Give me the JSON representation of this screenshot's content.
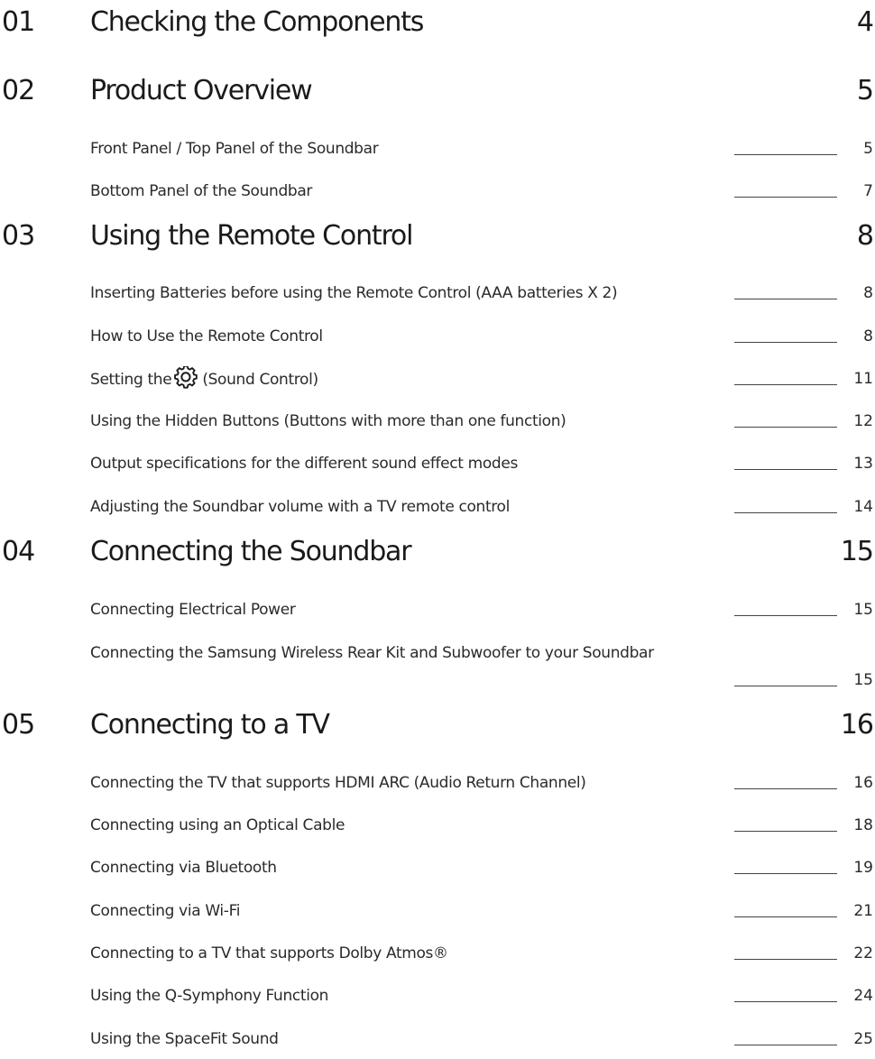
{
  "toc": {
    "chapters": [
      {
        "number": "01",
        "title": "Checking the Components",
        "page": "4",
        "entries": []
      },
      {
        "number": "02",
        "title": "Product Overview",
        "page": "5",
        "entries": [
          {
            "title": "Front Panel / Top Panel of the Soundbar",
            "page": "5"
          },
          {
            "title": "Bottom Panel of the Soundbar",
            "page": "7"
          }
        ]
      },
      {
        "number": "03",
        "title": "Using the Remote Control",
        "page": "8",
        "entries": [
          {
            "title": "Inserting Batteries before using the Remote Control (AAA batteries X 2)",
            "page": "8"
          },
          {
            "title": "How to Use the Remote Control",
            "page": "8"
          },
          {
            "title_prefix": "Setting the",
            "icon": "gear-icon",
            "title_suffix": "(Sound Control)",
            "page": "11"
          },
          {
            "title": "Using the Hidden Buttons (Buttons with more than one function)",
            "page": "12"
          },
          {
            "title": "Output specifications for the different sound effect modes",
            "page": "13"
          },
          {
            "title": "Adjusting the Soundbar volume with a TV remote control",
            "page": "14"
          }
        ]
      },
      {
        "number": "04",
        "title": "Connecting the Soundbar",
        "page": "15",
        "entries": [
          {
            "title": "Connecting Electrical Power",
            "page": "15"
          },
          {
            "title": "Connecting the Samsung Wireless Rear Kit and Subwoofer to your Soundbar",
            "page": "15"
          }
        ]
      },
      {
        "number": "05",
        "title": "Connecting to a TV",
        "page": "16",
        "entries": [
          {
            "title": "Connecting the TV that supports HDMI ARC (Audio Return Channel)",
            "page": "16"
          },
          {
            "title": "Connecting using an Optical Cable",
            "page": "18"
          },
          {
            "title": "Connecting via Bluetooth",
            "page": "19"
          },
          {
            "title": "Connecting via Wi-Fi",
            "page": "21"
          },
          {
            "title": "Connecting to a TV that supports Dolby Atmos®",
            "page": "22"
          },
          {
            "title": "Using the Q-Symphony Function",
            "page": "24"
          },
          {
            "title": "Using the SpaceFit Sound",
            "page": "25"
          }
        ]
      }
    ]
  }
}
